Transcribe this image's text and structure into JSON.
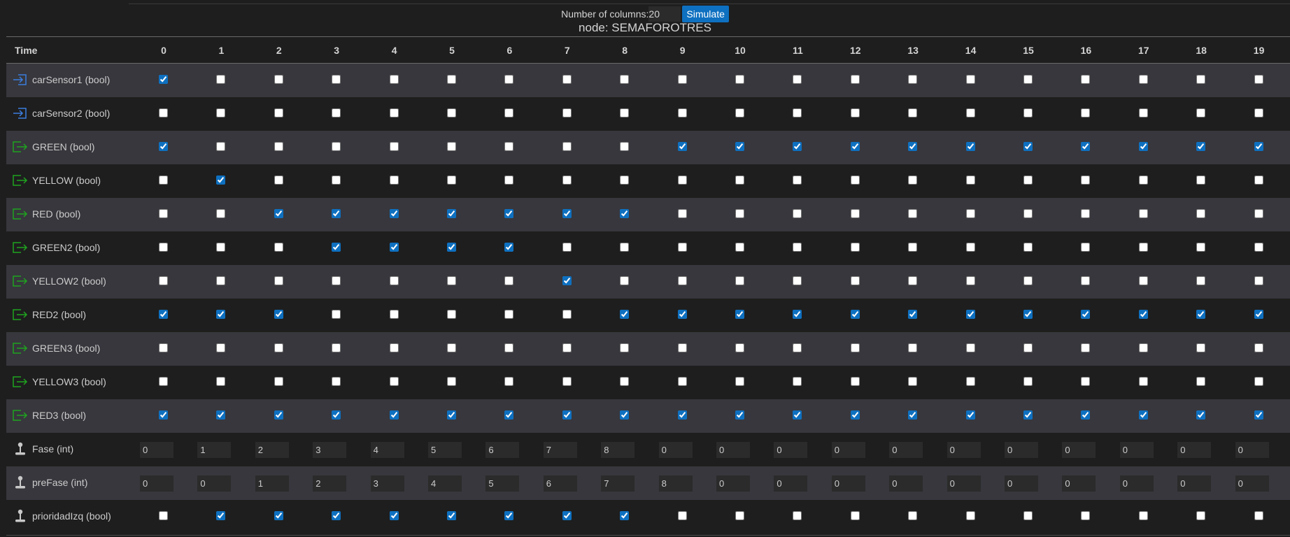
{
  "controls": {
    "columns_label": "Number of columns:",
    "columns_value": "20",
    "simulate_label": "Simulate"
  },
  "node_title": "node: SEMAFOROTRES",
  "table": {
    "time_header": "Time",
    "columns": [
      "0",
      "1",
      "2",
      "3",
      "4",
      "5",
      "6",
      "7",
      "8",
      "9",
      "10",
      "11",
      "12",
      "13",
      "14",
      "15",
      "16",
      "17",
      "18",
      "19"
    ],
    "rows": [
      {
        "label": "carSensor1 (bool)",
        "kind": "input",
        "type": "bool",
        "values": [
          1,
          0,
          0,
          0,
          0,
          0,
          0,
          0,
          0,
          0,
          0,
          0,
          0,
          0,
          0,
          0,
          0,
          0,
          0,
          0
        ]
      },
      {
        "label": "carSensor2 (bool)",
        "kind": "input",
        "type": "bool",
        "values": [
          0,
          0,
          0,
          0,
          0,
          0,
          0,
          0,
          0,
          0,
          0,
          0,
          0,
          0,
          0,
          0,
          0,
          0,
          0,
          0
        ]
      },
      {
        "label": "GREEN (bool)",
        "kind": "output",
        "type": "bool",
        "values": [
          1,
          0,
          0,
          0,
          0,
          0,
          0,
          0,
          0,
          1,
          1,
          1,
          1,
          1,
          1,
          1,
          1,
          1,
          1,
          1
        ]
      },
      {
        "label": "YELLOW (bool)",
        "kind": "output",
        "type": "bool",
        "values": [
          0,
          1,
          0,
          0,
          0,
          0,
          0,
          0,
          0,
          0,
          0,
          0,
          0,
          0,
          0,
          0,
          0,
          0,
          0,
          0
        ]
      },
      {
        "label": "RED (bool)",
        "kind": "output",
        "type": "bool",
        "values": [
          0,
          0,
          1,
          1,
          1,
          1,
          1,
          1,
          1,
          0,
          0,
          0,
          0,
          0,
          0,
          0,
          0,
          0,
          0,
          0
        ]
      },
      {
        "label": "GREEN2 (bool)",
        "kind": "output",
        "type": "bool",
        "values": [
          0,
          0,
          0,
          1,
          1,
          1,
          1,
          0,
          0,
          0,
          0,
          0,
          0,
          0,
          0,
          0,
          0,
          0,
          0,
          0
        ]
      },
      {
        "label": "YELLOW2 (bool)",
        "kind": "output",
        "type": "bool",
        "values": [
          0,
          0,
          0,
          0,
          0,
          0,
          0,
          1,
          0,
          0,
          0,
          0,
          0,
          0,
          0,
          0,
          0,
          0,
          0,
          0
        ]
      },
      {
        "label": "RED2 (bool)",
        "kind": "output",
        "type": "bool",
        "values": [
          1,
          1,
          1,
          0,
          0,
          0,
          0,
          0,
          1,
          1,
          1,
          1,
          1,
          1,
          1,
          1,
          1,
          1,
          1,
          1
        ]
      },
      {
        "label": "GREEN3 (bool)",
        "kind": "output",
        "type": "bool",
        "values": [
          0,
          0,
          0,
          0,
          0,
          0,
          0,
          0,
          0,
          0,
          0,
          0,
          0,
          0,
          0,
          0,
          0,
          0,
          0,
          0
        ]
      },
      {
        "label": "YELLOW3 (bool)",
        "kind": "output",
        "type": "bool",
        "values": [
          0,
          0,
          0,
          0,
          0,
          0,
          0,
          0,
          0,
          0,
          0,
          0,
          0,
          0,
          0,
          0,
          0,
          0,
          0,
          0
        ]
      },
      {
        "label": "RED3 (bool)",
        "kind": "output",
        "type": "bool",
        "values": [
          1,
          1,
          1,
          1,
          1,
          1,
          1,
          1,
          1,
          1,
          1,
          1,
          1,
          1,
          1,
          1,
          1,
          1,
          1,
          1
        ]
      },
      {
        "label": "Fase (int)",
        "kind": "local",
        "type": "int",
        "values": [
          "0",
          "1",
          "2",
          "3",
          "4",
          "5",
          "6",
          "7",
          "8",
          "0",
          "0",
          "0",
          "0",
          "0",
          "0",
          "0",
          "0",
          "0",
          "0",
          "0"
        ]
      },
      {
        "label": "preFase (int)",
        "kind": "local",
        "type": "int",
        "values": [
          "0",
          "0",
          "1",
          "2",
          "3",
          "4",
          "5",
          "6",
          "7",
          "8",
          "0",
          "0",
          "0",
          "0",
          "0",
          "0",
          "0",
          "0",
          "0",
          "0"
        ]
      },
      {
        "label": "prioridadIzq (bool)",
        "kind": "local",
        "type": "bool",
        "values": [
          0,
          1,
          1,
          1,
          1,
          1,
          1,
          1,
          1,
          0,
          0,
          0,
          0,
          0,
          0,
          0,
          0,
          0,
          0,
          0
        ]
      }
    ]
  },
  "icons": {
    "input": "input-arrow-icon",
    "output": "output-arrow-icon",
    "local": "joystick-icon"
  },
  "colors": {
    "accent": "#0e70c0",
    "input_icon": "#3b7ddd",
    "output_icon": "#1fa31f",
    "local_icon": "#c8c8c8"
  }
}
